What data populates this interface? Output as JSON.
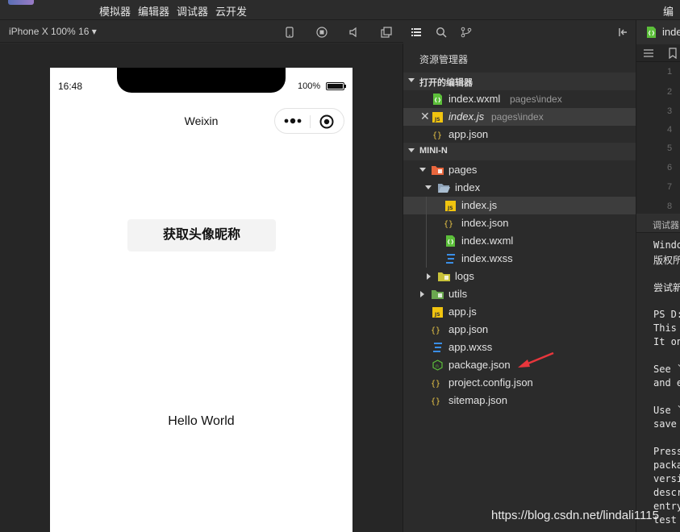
{
  "menu": {
    "items": [
      "模拟器",
      "编辑器",
      "调试器",
      "云开发"
    ],
    "compile": "编译"
  },
  "simulator": {
    "device_select": "iPhone X 100% 16 ▾",
    "status": {
      "time": "16:48",
      "battery": "100%"
    },
    "nav_title": "Weixin",
    "button_label": "获取头像昵称",
    "hello_text": "Hello World"
  },
  "explorer": {
    "title": "资源管理器",
    "open_editors": {
      "label": "打开的编辑器",
      "items": [
        {
          "name": "index.wxml",
          "path": "pages\\index"
        },
        {
          "name": "index.js",
          "path": "pages\\index",
          "close": "✕"
        },
        {
          "name": "app.json"
        }
      ]
    },
    "project": {
      "label": "MINI-N",
      "tree": [
        "pages",
        "index",
        "index.js",
        "index.json",
        "index.wxml",
        "index.wxss",
        "logs",
        "utils",
        "app.js",
        "app.json",
        "app.wxss",
        "package.json",
        "project.config.json",
        "sitemap.json"
      ]
    }
  },
  "editor": {
    "tab": "inde",
    "line_numbers": [
      "1",
      "2",
      "3",
      "4",
      "5",
      "6",
      "7",
      "8"
    ]
  },
  "debugger": {
    "tab": "调试器",
    "console": [
      "Windo",
      "版权所",
      "尝试新",
      "PS D:",
      "This ",
      "It on",
      "See `",
      "and e",
      "Use `",
      "save ",
      "Press",
      "packa",
      "versi",
      "descr",
      "entry",
      "test "
    ]
  },
  "watermark": "https://blog.csdn.net/lindali1115",
  "colors": {
    "arrow": "#e8363c",
    "wxml_green": "#5cbf3a",
    "js_yellow": "#f1c40f",
    "json_yellow": "#e8c547",
    "wxss_blue": "#3a8ee6",
    "folder_orange": "#e8663d",
    "folder_green": "#6aa84f"
  }
}
